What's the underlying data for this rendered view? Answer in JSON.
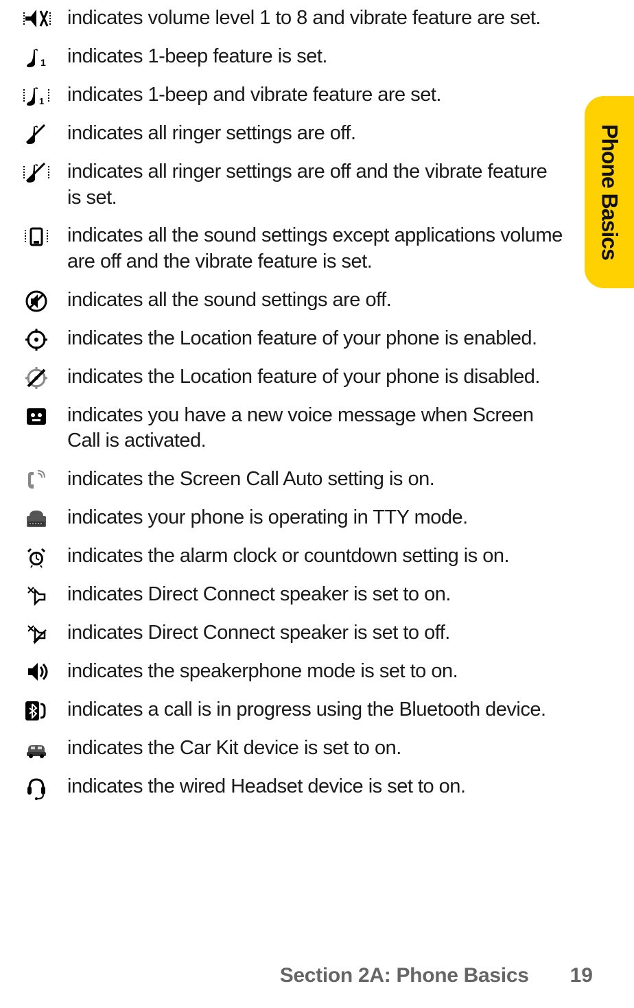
{
  "sideTab": "Phone Basics",
  "items": [
    {
      "icon": "volume-vibrate-icon",
      "text": "indicates volume level 1 to 8 and vibrate feature are set."
    },
    {
      "icon": "beep1-icon",
      "text": "indicates 1-beep feature is set."
    },
    {
      "icon": "beep1-vibrate-icon",
      "text": "indicates 1-beep and vibrate feature are set."
    },
    {
      "icon": "ringer-off-icon",
      "text": "indicates all ringer settings are off."
    },
    {
      "icon": "ringer-off-vibrate-icon",
      "text": "indicates all ringer settings are off and the vibrate feature is set."
    },
    {
      "icon": "sound-off-vibrate-icon",
      "text": "indicates all the sound settings except applications volume are off and the vibrate feature is set."
    },
    {
      "icon": "sound-off-icon",
      "text": "indicates all the sound settings are off."
    },
    {
      "icon": "location-on-icon",
      "text": "indicates the Location feature of your phone is enabled."
    },
    {
      "icon": "location-off-icon",
      "text": "indicates the Location feature of your phone is disabled."
    },
    {
      "icon": "voicemail-screencall-icon",
      "text": "indicates you have a new voice message when Screen Call is activated."
    },
    {
      "icon": "screencall-auto-icon",
      "text": "indicates the Screen Call Auto setting is on."
    },
    {
      "icon": "tty-icon",
      "text": "indicates your phone is operating in TTY mode."
    },
    {
      "icon": "alarm-icon",
      "text": "indicates the alarm clock or countdown setting is on."
    },
    {
      "icon": "dc-speaker-on-icon",
      "text": "indicates Direct Connect speaker is set to on."
    },
    {
      "icon": "dc-speaker-off-icon",
      "text": "indicates Direct Connect speaker is set to off."
    },
    {
      "icon": "speakerphone-icon",
      "text": "indicates the speakerphone mode is set to on."
    },
    {
      "icon": "bluetooth-call-icon",
      "text": "indicates a call is in progress using the Bluetooth device."
    },
    {
      "icon": "carkit-icon",
      "text": "indicates the Car Kit device is set to on."
    },
    {
      "icon": "headset-icon",
      "text": "indicates the wired Headset device is set to on."
    }
  ],
  "footer": {
    "section": "Section 2A: Phone Basics",
    "page": "19"
  }
}
